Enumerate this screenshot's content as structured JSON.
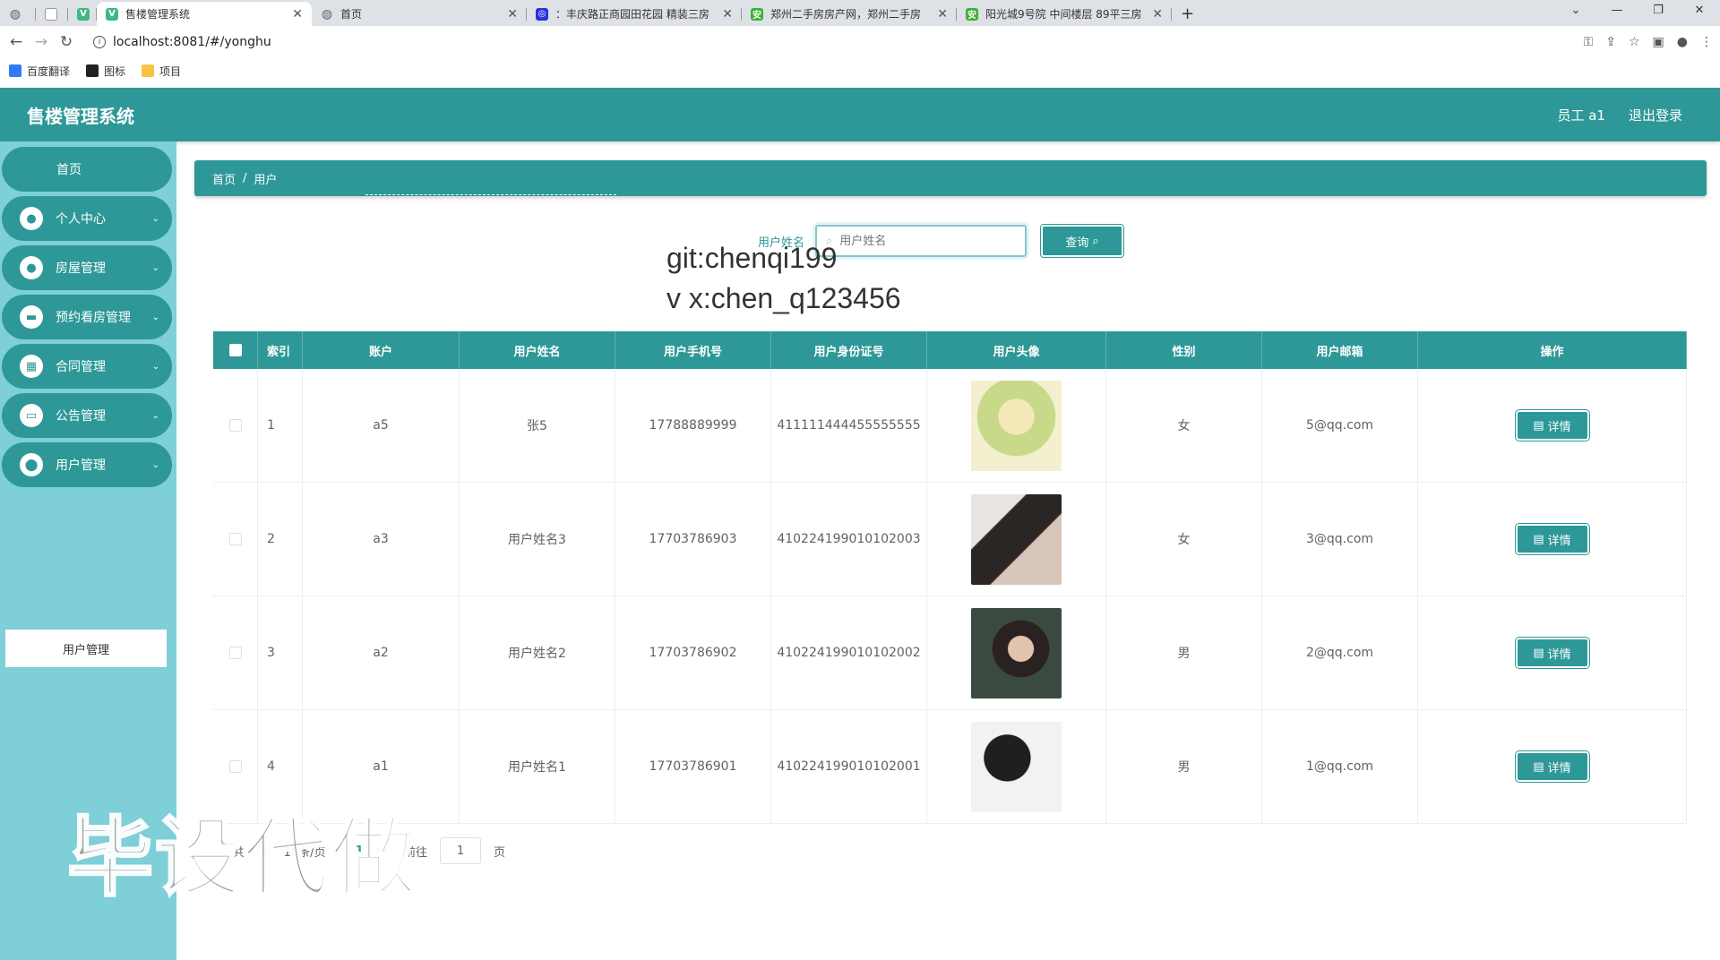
{
  "browser": {
    "tabs": [
      {
        "title": "",
        "icon": "globe-icon",
        "color": "#5f6368"
      },
      {
        "title": "",
        "icon": "blank-icon",
        "color": "#ffffff"
      },
      {
        "title": "",
        "icon": "vue-icon",
        "color": "#41b883"
      },
      {
        "title": "售楼管理系统",
        "icon": "vue-icon",
        "color": "#41b883",
        "active": true
      },
      {
        "title": "首页",
        "icon": "globe-icon",
        "color": "#5f6368"
      },
      {
        "title": "：丰庆路正商园田花园 精装三房",
        "icon": "baidu-icon",
        "color": "#2932e1"
      },
      {
        "title": "郑州二手房房产网，郑州二手房",
        "icon": "anjuke-icon",
        "color": "#3cb034"
      },
      {
        "title": "阳光城9号院 中间楼层 89平三房",
        "icon": "anjuke-icon",
        "color": "#3cb034"
      }
    ],
    "new_tab": "+",
    "url": "localhost:8081/#/yonghu",
    "bookmarks": [
      {
        "label": "百度翻译",
        "color": "#2e7cf6"
      },
      {
        "label": "图标",
        "color": "#222222"
      },
      {
        "label": "项目",
        "color": "#f5c542"
      }
    ]
  },
  "header": {
    "title": "售楼管理系统",
    "user": "员工 a1",
    "logout": "退出登录",
    "color": "#2e9898"
  },
  "sidebar": {
    "home": "首页",
    "items": [
      {
        "label": "个人中心",
        "icon": "user-icon"
      },
      {
        "label": "房屋管理",
        "icon": "user-icon"
      },
      {
        "label": "预约看房管理",
        "icon": "briefcase-icon"
      },
      {
        "label": "合同管理",
        "icon": "grid-icon"
      },
      {
        "label": "公告管理",
        "icon": "monitor-icon"
      },
      {
        "label": "用户管理",
        "icon": "location-icon"
      }
    ],
    "sub_item": "用户管理"
  },
  "breadcrumb": {
    "home": "首页",
    "sep": "/",
    "current": "用户"
  },
  "search": {
    "label": "用户姓名",
    "placeholder": "用户姓名",
    "button": "查询"
  },
  "overlay": {
    "line1": "git:chenqi199",
    "line2": "v x:chen_q123456"
  },
  "table": {
    "headers": [
      "索引",
      "账户",
      "用户姓名",
      "用户手机号",
      "用户身份证号",
      "用户头像",
      "性别",
      "用户邮箱",
      "操作"
    ],
    "rows": [
      {
        "index": "1",
        "account": "a5",
        "name": "张5",
        "phone": "17788889999",
        "id_no": "411111444455555555",
        "gender": "女",
        "email": "5@qq.com",
        "action": "详情"
      },
      {
        "index": "2",
        "account": "a3",
        "name": "用户姓名3",
        "phone": "17703786903",
        "id_no": "410224199010102003",
        "gender": "女",
        "email": "3@qq.com",
        "action": "详情"
      },
      {
        "index": "3",
        "account": "a2",
        "name": "用户姓名2",
        "phone": "17703786902",
        "id_no": "410224199010102002",
        "gender": "男",
        "email": "2@qq.com",
        "action": "详情"
      },
      {
        "index": "4",
        "account": "a1",
        "name": "用户姓名1",
        "phone": "17703786901",
        "id_no": "410224199010102001",
        "gender": "男",
        "email": "1@qq.com",
        "action": "详情"
      }
    ]
  },
  "pager": {
    "total": "共 4 条",
    "page_size": "10条/页",
    "current": "1",
    "next": "›",
    "goto_label": "前往",
    "goto_value": "1",
    "goto_unit": "页"
  },
  "watermark": "毕设代做"
}
